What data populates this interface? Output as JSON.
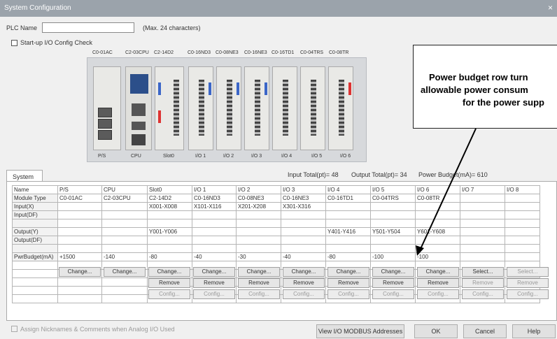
{
  "window": {
    "title": "System Configuration",
    "close": "×"
  },
  "plc": {
    "label": "PLC Name",
    "value": "",
    "hint": "(Max. 24 characters)"
  },
  "startup_check": {
    "label": "Start-up I/O Config Check",
    "checked": false
  },
  "rack_modules": [
    "C0-01AC",
    "C2-03CPU",
    "C2-14D2",
    "C0-16ND3",
    "C0-08NE3",
    "C0-16NE3",
    "C0-16TD1",
    "C0-04TRS",
    "C0-08TR"
  ],
  "rack_slots": [
    "P/S",
    "CPU",
    "Slot0",
    "I/O 1",
    "I/O 2",
    "I/O 3",
    "I/O 4",
    "I/O 5",
    "I/O 6"
  ],
  "tab": "System",
  "totals": {
    "input": "Input Total(pt)= 48",
    "output": "Output Total(pt)= 34",
    "power": "Power Budget(mA)= 610"
  },
  "table": {
    "columns": [
      "Name",
      "P/S",
      "CPU",
      "Slot0",
      "I/O 1",
      "I/O 2",
      "I/O 3",
      "I/O 4",
      "I/O 5",
      "I/O 6",
      "I/O 7",
      "I/O 8"
    ],
    "rows": [
      {
        "label": "Module Type",
        "cells": [
          "C0-01AC",
          "C2-03CPU",
          "C2-14D2",
          "C0-16ND3",
          "C0-08NE3",
          "C0-16NE3",
          "C0-16TD1",
          "C0-04TRS",
          "C0-08TR",
          "",
          ""
        ]
      },
      {
        "label": "Input(X)",
        "cells": [
          "",
          "",
          "X001-X008",
          "X101-X116",
          "X201-X208",
          "X301-X316",
          "",
          "",
          "",
          "",
          ""
        ]
      },
      {
        "label": "Input(DF)",
        "cells": [
          "",
          "",
          "",
          "",
          "",
          "",
          "",
          "",
          "",
          "",
          ""
        ]
      },
      {
        "label": "",
        "cells": [
          "",
          "",
          "",
          "",
          "",
          "",
          "",
          "",
          "",
          "",
          ""
        ]
      },
      {
        "label": "Output(Y)",
        "cells": [
          "",
          "",
          "Y001-Y006",
          "",
          "",
          "",
          "Y401-Y416",
          "Y501-Y504",
          "Y601-Y608",
          "",
          ""
        ]
      },
      {
        "label": "Output(DF)",
        "cells": [
          "",
          "",
          "",
          "",
          "",
          "",
          "",
          "",
          "",
          "",
          ""
        ]
      },
      {
        "label": "",
        "cells": [
          "",
          "",
          "",
          "",
          "",
          "",
          "",
          "",
          "",
          "",
          ""
        ]
      },
      {
        "label": "PwrBudget(mA)",
        "cells": [
          "+1500",
          "-140",
          "-80",
          "-40",
          "-30",
          "-40",
          "-80",
          "-100",
          "-100",
          "",
          ""
        ]
      }
    ]
  },
  "buttons": {
    "change": "Change...",
    "select": "Select...",
    "remove": "Remove",
    "config": "Config..."
  },
  "footer": {
    "nicknames": "Assign Nicknames & Comments when Analog I/O Used",
    "modbus": "View I/O MODBUS Addresses",
    "ok": "OK",
    "cancel": "Cancel",
    "help": "Help"
  },
  "callout": {
    "line1": "Power budget row turn",
    "line2": "allowable power consum",
    "line3": "for the power supp"
  }
}
